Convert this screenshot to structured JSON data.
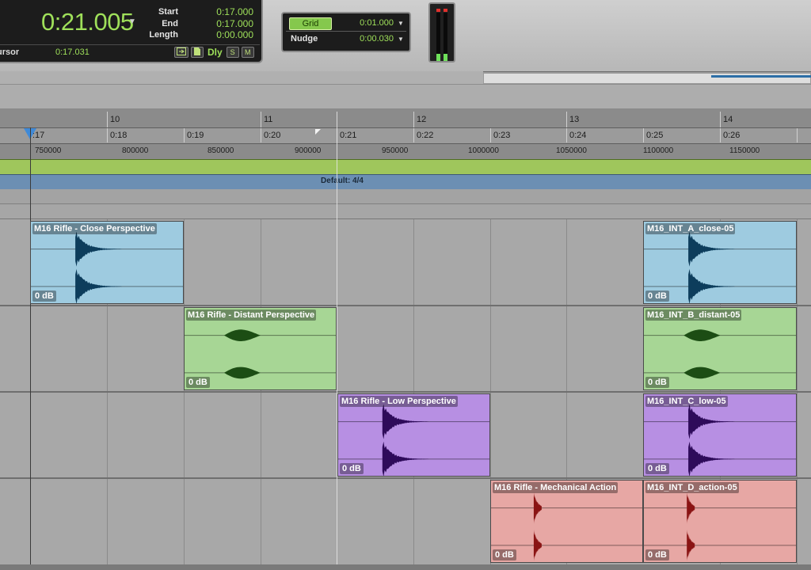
{
  "counter": {
    "main_value": "0:21.005",
    "start_label": "Start",
    "start_value": "0:17.000",
    "end_label": "End",
    "end_value": "0:17.000",
    "length_label": "Length",
    "length_value": "0:00.000",
    "cursor_label": "ursor",
    "cursor_value": "0:17.031",
    "dly_label": "Dly",
    "small_buttons": [
      "S",
      "M"
    ]
  },
  "grid": {
    "grid_label": "Grid",
    "grid_value": "0:01.000",
    "nudge_label": "Nudge",
    "nudge_value": "0:00.030"
  },
  "rulers": {
    "bars": [
      "10",
      "11",
      "12",
      "13",
      "14"
    ],
    "minsecs": [
      ":17",
      "0:18",
      "0:19",
      "0:20",
      "0:21",
      "0:22",
      "0:23",
      "0:24",
      "0:25",
      "0:26"
    ],
    "samples": [
      "750000",
      "800000",
      "850000",
      "900000",
      "950000",
      "1000000",
      "1050000",
      "1100000",
      "1150000"
    ],
    "meter": "Default: 4/4"
  },
  "clips": [
    {
      "name": "M16 Rifle - Close Perspective",
      "gain": "0 dB",
      "color": "#9ecbe0",
      "wave": "#0d3d5c"
    },
    {
      "name": "M16_INT_A_close-05",
      "gain": "0 dB",
      "color": "#9ecbe0",
      "wave": "#0d3d5c"
    },
    {
      "name": "M16 Rifle - Distant Perspective",
      "gain": "0 dB",
      "color": "#a7d695",
      "wave": "#1c4d14"
    },
    {
      "name": "M16_INT_B_distant-05",
      "gain": "0 dB",
      "color": "#a7d695",
      "wave": "#1c4d14"
    },
    {
      "name": "M16 Rifle - Low Perspective",
      "gain": "0 dB",
      "color": "#b78fe3",
      "wave": "#2e0b5a"
    },
    {
      "name": "M16_INT_C_low-05",
      "gain": "0 dB",
      "color": "#b78fe3",
      "wave": "#2e0b5a"
    },
    {
      "name": "M16 Rifle - Mechanical Action",
      "gain": "0 dB",
      "color": "#e7a7a4",
      "wave": "#8a1414"
    },
    {
      "name": "M16_INT_D_action-05",
      "gain": "0 dB",
      "color": "#e7a7a4",
      "wave": "#8a1414"
    }
  ],
  "colors": {
    "counter_green": "#9fe05a",
    "marker_ruler": "#9fc65c",
    "meter_ruler": "#6c8fb3",
    "playhead_marker": "#3f8ad8"
  },
  "icons": {
    "dropdown": "triangle-down-icon",
    "marker": "blue-arrow-down-icon",
    "gain": "gain-icon"
  }
}
